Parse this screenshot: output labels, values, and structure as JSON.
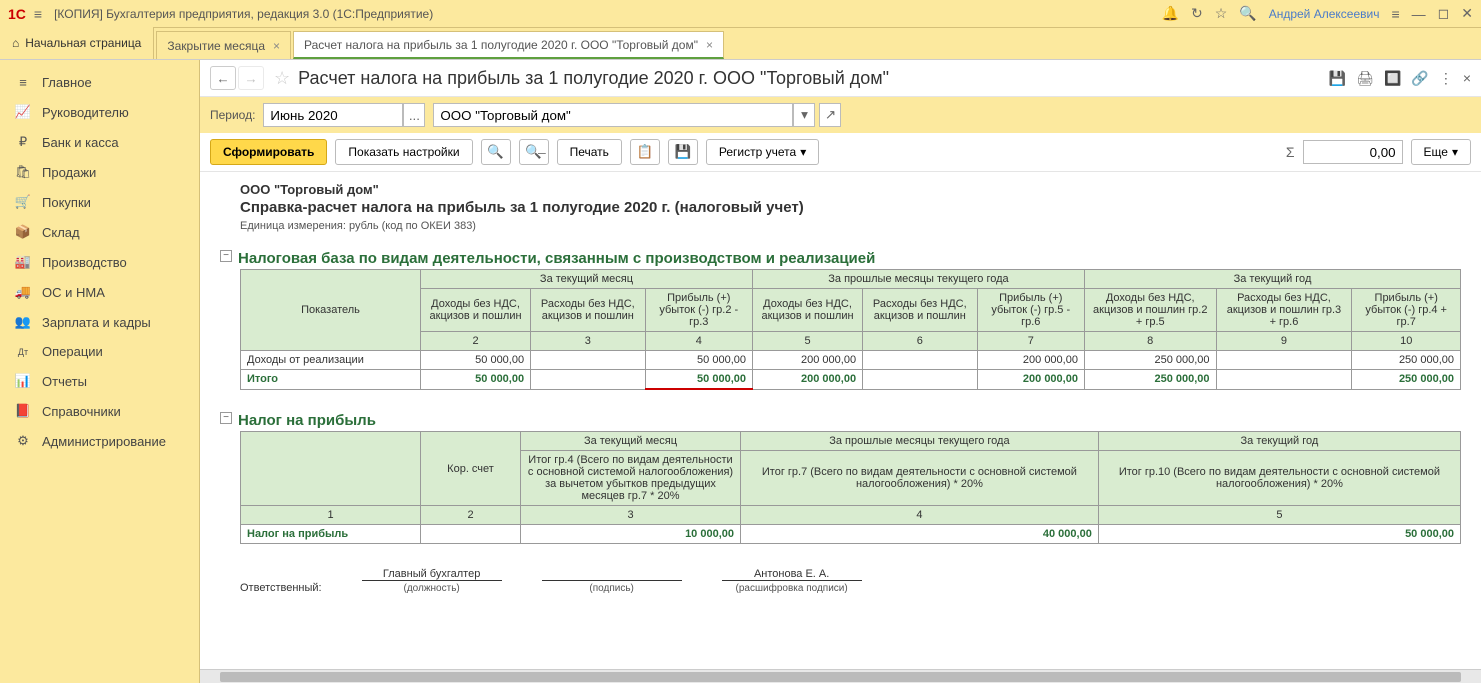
{
  "titlebar": {
    "logo": "1С",
    "title": "[КОПИЯ] Бухгалтерия предприятия, редакция 3.0  (1С:Предприятие)",
    "user": "Андрей Алексеевич"
  },
  "tabs": {
    "home": "Начальная страница",
    "items": [
      {
        "label": "Закрытие месяца",
        "active": false
      },
      {
        "label": "Расчет налога на прибыль за 1 полугодие 2020 г. ООО \"Торговый дом\"",
        "active": true
      }
    ]
  },
  "sidebar": [
    {
      "icon": "≡",
      "label": "Главное"
    },
    {
      "icon": "📈",
      "label": "Руководителю"
    },
    {
      "icon": "₽",
      "label": "Банк и касса"
    },
    {
      "icon": "🛍",
      "label": "Продажи"
    },
    {
      "icon": "🛒",
      "label": "Покупки"
    },
    {
      "icon": "📦",
      "label": "Склад"
    },
    {
      "icon": "🏭",
      "label": "Производство"
    },
    {
      "icon": "🚚",
      "label": "ОС и НМА"
    },
    {
      "icon": "👥",
      "label": "Зарплата и кадры"
    },
    {
      "icon": "Дт",
      "label": "Операции"
    },
    {
      "icon": "📊",
      "label": "Отчеты"
    },
    {
      "icon": "📕",
      "label": "Справочники"
    },
    {
      "icon": "⚙",
      "label": "Администрирование"
    }
  ],
  "page": {
    "title": "Расчет налога на прибыль за 1 полугодие 2020 г. ООО \"Торговый дом\""
  },
  "filter": {
    "period_label": "Период:",
    "period_value": "Июнь 2020",
    "org_value": "ООО \"Торговый дом\""
  },
  "actions": {
    "generate": "Сформировать",
    "show_settings": "Показать настройки",
    "print": "Печать",
    "register": "Регистр учета",
    "sum_value": "0,00",
    "more": "Еще"
  },
  "report": {
    "org": "ООО \"Торговый дом\"",
    "title": "Справка-расчет налога на прибыль за 1 полугодие 2020 г. (налоговый учет)",
    "unit": "Единица измерения:  рубль (код по ОКЕИ 383)",
    "section1": {
      "title": "Налоговая база по видам деятельности, связанным с производством и реализацией",
      "head_indicator": "Показатель",
      "groups": [
        "За текущий месяц",
        "За прошлые месяцы текущего года",
        "За текущий год"
      ],
      "subheads": [
        "Доходы без НДС, акцизов и пошлин",
        "Расходы без НДС, акцизов и пошлин",
        "Прибыль (+)\nубыток (-)\nгр.2 - гр.3",
        "Доходы без НДС, акцизов и пошлин",
        "Расходы без НДС, акцизов и пошлин",
        "Прибыль (+)\nубыток (-)\nгр.5 - гр.6",
        "Доходы без НДС, акцизов и пошлин\nгр.2 + гр.5",
        "Расходы без НДС, акцизов и пошлин\nгр.3 + гр.6",
        "Прибыль (+)\nубыток (-)\nгр.4 + гр.7"
      ],
      "colnums": [
        "2",
        "3",
        "4",
        "5",
        "6",
        "7",
        "8",
        "9",
        "10"
      ],
      "row1_label": "Доходы от реализации",
      "row1": [
        "50 000,00",
        "",
        "50 000,00",
        "200 000,00",
        "",
        "200 000,00",
        "250 000,00",
        "",
        "250 000,00"
      ],
      "total_label": "Итого",
      "total": [
        "50 000,00",
        "",
        "50 000,00",
        "200 000,00",
        "",
        "200 000,00",
        "250 000,00",
        "",
        "250 000,00"
      ]
    },
    "section2": {
      "title": "Налог на прибыль",
      "head_account": "Кор. счет",
      "groups": [
        "За текущий месяц",
        "За прошлые месяцы текущего года",
        "За текущий год"
      ],
      "subheads": [
        "Итог гр.4 (Всего по видам деятельности с основной системой налогообложения) за вычетом убытков предыдущих месяцев гр.7 * 20%",
        "Итог гр.7 (Всего по видам деятельности с основной системой налогообложения) * 20%",
        "Итог гр.10 (Всего по видам деятельности с основной системой налогообложения) * 20%"
      ],
      "colnums": [
        "1",
        "2",
        "3",
        "4",
        "5"
      ],
      "row_label": "Налог на прибыль",
      "row": [
        "",
        "10 000,00",
        "40 000,00",
        "50 000,00"
      ]
    },
    "signatures": {
      "responsible": "Ответственный:",
      "position_value": "Главный бухгалтер",
      "position_caption": "(должность)",
      "sign_caption": "(подпись)",
      "name_value": "Антонова Е. А.",
      "name_caption": "(расшифровка подписи)"
    }
  }
}
